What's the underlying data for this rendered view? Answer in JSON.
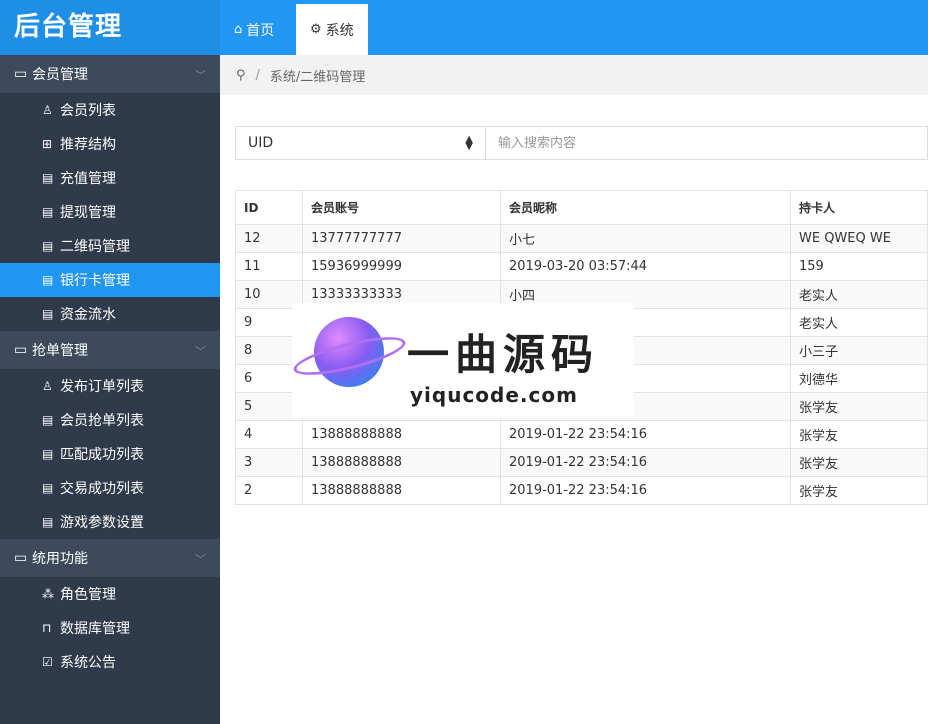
{
  "sidebar": {
    "logo": "后台管理",
    "groups": [
      {
        "label": "会员管理",
        "items": [
          {
            "label": "会员列表",
            "icon": "user-icon",
            "glyph": "♙"
          },
          {
            "label": "推荐结构",
            "icon": "grid-icon",
            "glyph": "⊞"
          },
          {
            "label": "充值管理",
            "icon": "document-icon",
            "glyph": "▤"
          },
          {
            "label": "提现管理",
            "icon": "document-icon",
            "glyph": "▤"
          },
          {
            "label": "二维码管理",
            "icon": "document-icon",
            "glyph": "▤"
          },
          {
            "label": "银行卡管理",
            "icon": "document-icon",
            "glyph": "▤",
            "active": true
          },
          {
            "label": "资金流水",
            "icon": "document-icon",
            "glyph": "▤"
          }
        ]
      },
      {
        "label": "抢单管理",
        "items": [
          {
            "label": "发布订单列表",
            "icon": "user-icon",
            "glyph": "♙"
          },
          {
            "label": "会员抢单列表",
            "icon": "document-icon",
            "glyph": "▤"
          },
          {
            "label": "匹配成功列表",
            "icon": "document-icon",
            "glyph": "▤"
          },
          {
            "label": "交易成功列表",
            "icon": "document-icon",
            "glyph": "▤"
          },
          {
            "label": "游戏参数设置",
            "icon": "document-icon",
            "glyph": "▤"
          }
        ]
      },
      {
        "label": "统用功能",
        "items": [
          {
            "label": "角色管理",
            "icon": "sitemap-icon",
            "glyph": "⁂"
          },
          {
            "label": "数据库管理",
            "icon": "lock-icon",
            "glyph": "⊓"
          },
          {
            "label": "系统公告",
            "icon": "checkbox-icon",
            "glyph": "☑"
          }
        ]
      }
    ]
  },
  "topbar": {
    "tabs": [
      {
        "label": "首页",
        "icon": "home-icon",
        "glyph": "⌂"
      },
      {
        "label": "系统",
        "icon": "gear-icon",
        "glyph": "⚙"
      }
    ]
  },
  "breadcrumb": {
    "icon": "map-pin-icon",
    "glyph": "⚲",
    "separator": "/",
    "path": "系统/二维码管理"
  },
  "search": {
    "field_value": "UID",
    "placeholder": "输入搜索内容"
  },
  "table": {
    "headers": [
      "ID",
      "会员账号",
      "会员昵称",
      "持卡人"
    ],
    "rows": [
      [
        "12",
        "13777777777",
        "小七",
        "WE QWEQ WE"
      ],
      [
        "11",
        "15936999999",
        "2019-03-20 03:57:44",
        "159"
      ],
      [
        "10",
        "13333333333",
        "小四",
        "老实人"
      ],
      [
        "9",
        "",
        "",
        "老实人"
      ],
      [
        "8",
        "",
        "",
        "小三子"
      ],
      [
        "6",
        "",
        "",
        "刘德华"
      ],
      [
        "5",
        "",
        "",
        "张学友"
      ],
      [
        "4",
        "13888888888",
        "2019-01-22 23:54:16",
        "张学友"
      ],
      [
        "3",
        "13888888888",
        "2019-01-22 23:54:16",
        "张学友"
      ],
      [
        "2",
        "13888888888",
        "2019-01-22 23:54:16",
        "张学友"
      ]
    ]
  },
  "watermark": {
    "text_cn": "一曲源码",
    "text_en": "yiqucode.com"
  },
  "colors": {
    "sidebar_bg": "#2f3a4a",
    "group_bg": "#3c4a5c",
    "accent": "#2196f3"
  }
}
